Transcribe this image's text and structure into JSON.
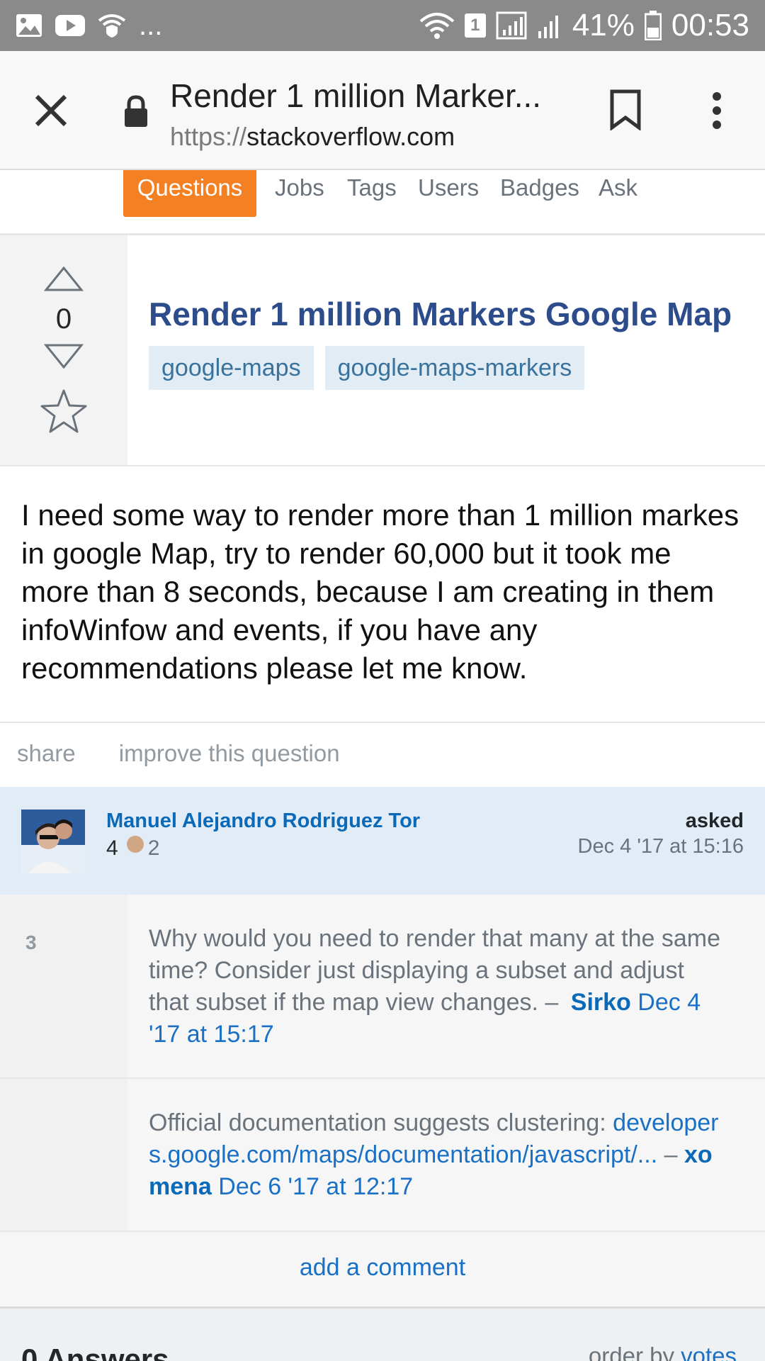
{
  "status_bar": {
    "left_icons": [
      "image-icon",
      "youtube-icon",
      "wifi-shield-icon"
    ],
    "more": "...",
    "sim_label": "1",
    "battery": "41%",
    "time": "00:53"
  },
  "browser": {
    "page_title": "Render 1 million Marker...",
    "url_scheme": "https://",
    "url_host": "stackoverflow.com"
  },
  "site_nav": {
    "items": [
      "Questions",
      "Jobs",
      "Tags",
      "Users",
      "Badges",
      "Ask"
    ],
    "active": "Questions",
    "accent": "#f48024"
  },
  "question": {
    "votes": "0",
    "title": "Render 1 million Markers Google Map",
    "tags": [
      "google-maps",
      "google-maps-markers"
    ],
    "body": "I need some way to render more than 1 million markes in google Map, try to render 60,000 but it took me more than 8 seconds, because I am creating in them infoWinfow and events, if you have any recommendations please let me know.",
    "actions": [
      "share",
      "improve this question"
    ]
  },
  "asker": {
    "name": "Manuel Alejandro Rodriguez Tor",
    "reputation": "4",
    "bronze_badges": "2",
    "asked_label": "asked",
    "asked_date": "Dec 4 '17 at 15:16"
  },
  "comments": [
    {
      "score": "3",
      "text": "Why would you need to render that many at the same time? Consider just displaying a subset and adjust that subset if the map view changes. –",
      "user": "Sirko",
      "date": "Dec 4 '17 at 15:17"
    },
    {
      "score": "",
      "text": "Official documentation suggests clustering:",
      "link": "developers.google.com/maps/documentation/javascript/...",
      "separator": "–",
      "user": "xomena",
      "date": "Dec 6 '17 at 12:17"
    }
  ],
  "add_comment": "add a comment",
  "answers": {
    "count_label": "0 Answers",
    "order_prefix": "order by",
    "order_value": "votes"
  }
}
